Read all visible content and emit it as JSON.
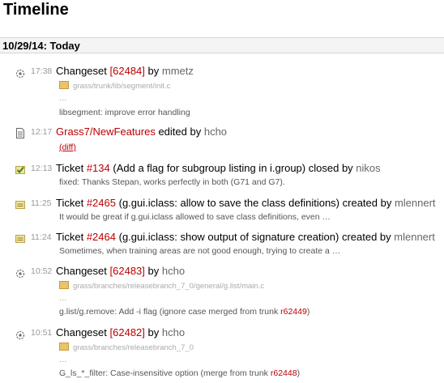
{
  "page": {
    "title": "Timeline"
  },
  "day": {
    "header": "10/29/14: Today"
  },
  "entries": [
    {
      "type": "changeset",
      "time": "17:38",
      "label": "Changeset",
      "ref": "[62484]",
      "by": "by",
      "author": "mmetz",
      "files": [
        "grass/trunk/lib/segment/init.c"
      ],
      "ellipsis": "…",
      "message": "libsegment: improve error handling"
    },
    {
      "type": "wiki",
      "time": "12:17",
      "page": "Grass7/NewFeatures",
      "action": "edited by",
      "author": "hcho",
      "diff": "(diff)"
    },
    {
      "type": "ticket-closed",
      "time": "12:13",
      "label": "Ticket",
      "ref": "#134",
      "summary": "(Add a flag for subgroup listing in i.group)",
      "action": "closed by",
      "author": "nikos",
      "message": "fixed: Thanks Stepan, works perfectly in both (G71 and G7)."
    },
    {
      "type": "ticket-new",
      "time": "11:25",
      "label": "Ticket",
      "ref": "#2465",
      "summary": "(g.gui.iclass: allow to save the class definitions)",
      "action": "created by",
      "author": "mlennert",
      "message": "It would be great if g.gui.iclass allowed to save class definitions, even …"
    },
    {
      "type": "ticket-new",
      "time": "11:24",
      "label": "Ticket",
      "ref": "#2464",
      "summary": "(g.gui.iclass: show output of signature creation)",
      "action": "created by",
      "author": "mlennert",
      "message": "Sometimes, when training areas are not good enough, trying to create a …"
    },
    {
      "type": "changeset",
      "time": "10:52",
      "label": "Changeset",
      "ref": "[62483]",
      "by": "by",
      "author": "hcho",
      "files": [
        "grass/branches/releasebranch_7_0/general/g.list/main.c"
      ],
      "ellipsis": "…",
      "message": "g.list/g.remove: Add -i flag (ignore case merged from trunk ",
      "message_link": "r62449",
      "message_end": ")"
    },
    {
      "type": "changeset",
      "time": "10:51",
      "label": "Changeset",
      "ref": "[62482]",
      "by": "by",
      "author": "hcho",
      "files": [
        "grass/branches/releasebranch_7_0"
      ],
      "ellipsis": "…",
      "message": "G_ls_*_filter: Case-insensitive option (merge from trunk ",
      "message_link": "r62448",
      "message_end": ")"
    }
  ],
  "icons": {
    "changeset": "changeset-icon",
    "wiki": "wiki-page-icon",
    "ticket-closed": "ticket-closed-icon",
    "ticket-new": "ticket-new-icon",
    "folder": "folder-icon"
  },
  "colors": {
    "link": "#bb0000",
    "time": "#999999",
    "author": "#666666",
    "header_bg": "#f4f4f4"
  }
}
